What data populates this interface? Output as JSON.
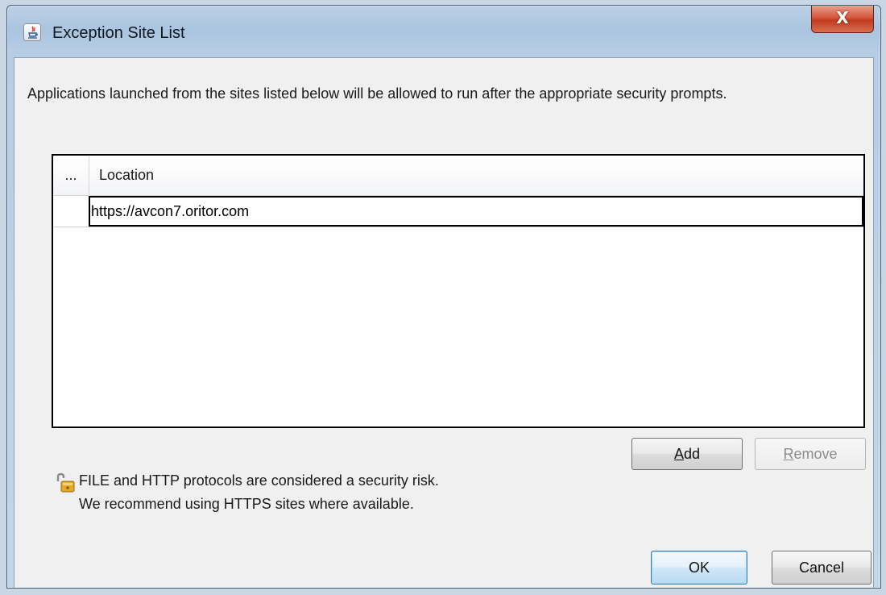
{
  "window": {
    "title": "Exception Site List",
    "close_label": "X",
    "icon": "java-icon"
  },
  "description": "Applications launched from the sites listed below will be allowed to run after the appropriate security prompts.",
  "table": {
    "columns": [
      "...",
      "Location"
    ],
    "rows": [
      {
        "location": "https://avcon7.oritor.com"
      }
    ]
  },
  "buttons": {
    "add": {
      "underlined": "A",
      "rest": "dd"
    },
    "remove": {
      "underlined": "R",
      "rest": "emove"
    },
    "ok": "OK",
    "cancel": "Cancel"
  },
  "warning": {
    "icon": "unlocked-padlock-icon",
    "line1": "FILE and HTTP protocols are considered a security risk.",
    "line2": "We recommend using HTTPS sites where available."
  }
}
